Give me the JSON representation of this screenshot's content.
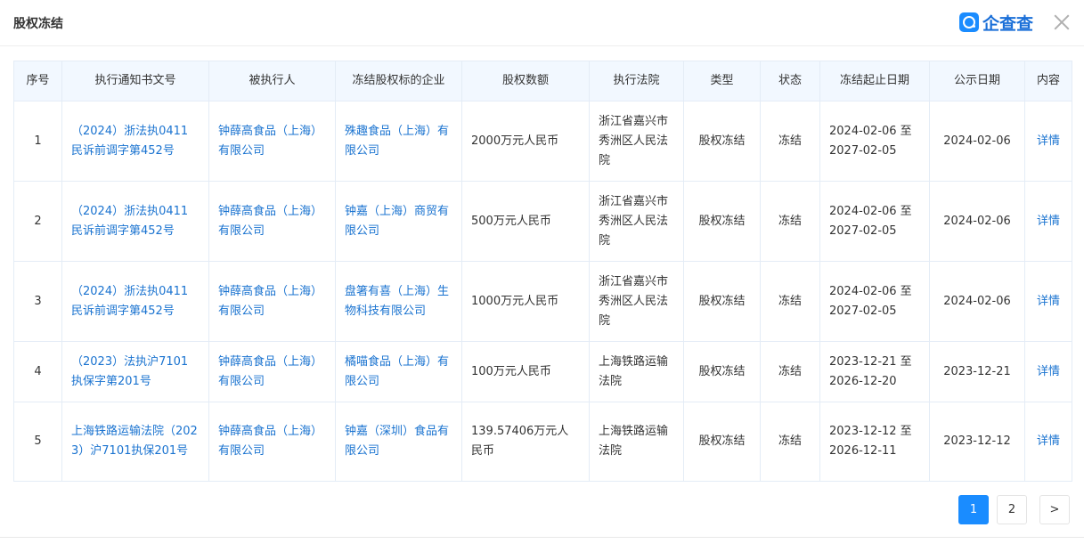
{
  "dialog": {
    "title": "股权冻结",
    "brand": "企查查"
  },
  "table": {
    "headers": [
      "序号",
      "执行通知书文号",
      "被执行人",
      "冻结股权标的企业",
      "股权数额",
      "执行法院",
      "类型",
      "状态",
      "冻结起止日期",
      "公示日期",
      "内容"
    ],
    "rows": [
      {
        "index": "1",
        "doc_no": "（2024）浙法执0411民诉前调字第452号",
        "executed": "钟薛高食品（上海）有限公司",
        "target": "殊趣食品（上海）有限公司",
        "amount": "2000万元人民币",
        "court": "浙江省嘉兴市秀洲区人民法院",
        "type": "股权冻结",
        "status": "冻结",
        "period": "2024-02-06 至 2027-02-05",
        "pub_date": "2024-02-06",
        "detail": "详情"
      },
      {
        "index": "2",
        "doc_no": "（2024）浙法执0411民诉前调字第452号",
        "executed": "钟薛高食品（上海）有限公司",
        "target": "钟嘉（上海）商贸有限公司",
        "amount": "500万元人民币",
        "court": "浙江省嘉兴市秀洲区人民法院",
        "type": "股权冻结",
        "status": "冻结",
        "period": "2024-02-06 至 2027-02-05",
        "pub_date": "2024-02-06",
        "detail": "详情"
      },
      {
        "index": "3",
        "doc_no": "（2024）浙法执0411民诉前调字第452号",
        "executed": "钟薛高食品（上海）有限公司",
        "target": "盘箸有喜（上海）生物科技有限公司",
        "amount": "1000万元人民币",
        "court": "浙江省嘉兴市秀洲区人民法院",
        "type": "股权冻结",
        "status": "冻结",
        "period": "2024-02-06 至 2027-02-05",
        "pub_date": "2024-02-06",
        "detail": "详情"
      },
      {
        "index": "4",
        "doc_no": "（2023）法执沪7101执保字第201号",
        "executed": "钟薛高食品（上海）有限公司",
        "target": "橘喵食品（上海）有限公司",
        "amount": "100万元人民币",
        "court": "上海铁路运输法院",
        "type": "股权冻结",
        "status": "冻结",
        "period": "2023-12-21 至 2026-12-20",
        "pub_date": "2023-12-21",
        "detail": "详情"
      },
      {
        "index": "5",
        "doc_no": "上海铁路运输法院（2023）沪7101执保201号",
        "executed": "钟薛高食品（上海）有限公司",
        "target": "钟嘉（深圳）食品有限公司",
        "amount": "139.57406万元人民币",
        "court": "上海铁路运输法院",
        "type": "股权冻结",
        "status": "冻结",
        "period": "2023-12-12 至 2026-12-11",
        "pub_date": "2023-12-12",
        "detail": "详情"
      }
    ]
  },
  "pagination": {
    "pages": [
      "1",
      "2"
    ],
    "next": ">",
    "active": "1"
  },
  "colors": {
    "accent": "#1a8cff",
    "link": "#1a73d0",
    "header_bg": "#f2f8ff"
  }
}
